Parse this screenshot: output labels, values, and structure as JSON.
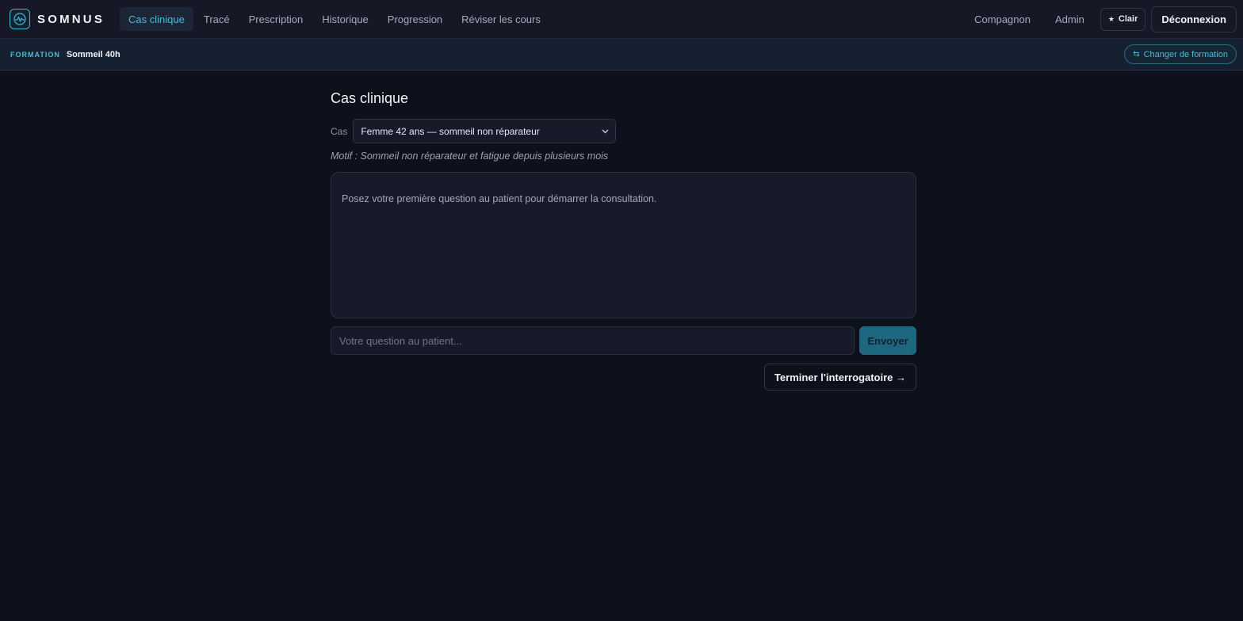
{
  "app": {
    "brand": "SOMNUS",
    "accent_color": "#44bcd9"
  },
  "nav": {
    "items": [
      {
        "label": "Cas clinique",
        "active": true
      },
      {
        "label": "Tracé",
        "active": false
      },
      {
        "label": "Prescription",
        "active": false
      },
      {
        "label": "Historique",
        "active": false
      },
      {
        "label": "Progression",
        "active": false
      },
      {
        "label": "Réviser les cours",
        "active": false
      }
    ],
    "right": {
      "compagnon": "Compagnon",
      "admin": "Admin",
      "theme_label": "Clair",
      "theme_icon": "star-icon",
      "logout": "Déconnexion"
    }
  },
  "formation": {
    "label": "FORMATION",
    "name": "Sommeil 40h",
    "change_label": "Changer de formation",
    "change_icon": "swap-icon"
  },
  "main": {
    "title": "Cas clinique",
    "case_label": "Cas",
    "case_selected": "Femme 42 ans — sommeil non réparateur",
    "motif": "Motif : Sommeil non réparateur et fatigue depuis plusieurs mois",
    "chat_placeholder": "Posez votre première question au patient pour démarrer la consultation.",
    "input_placeholder": "Votre question au patient...",
    "send_label": "Envoyer",
    "finish_label": "Terminer l'interrogatoire →"
  }
}
